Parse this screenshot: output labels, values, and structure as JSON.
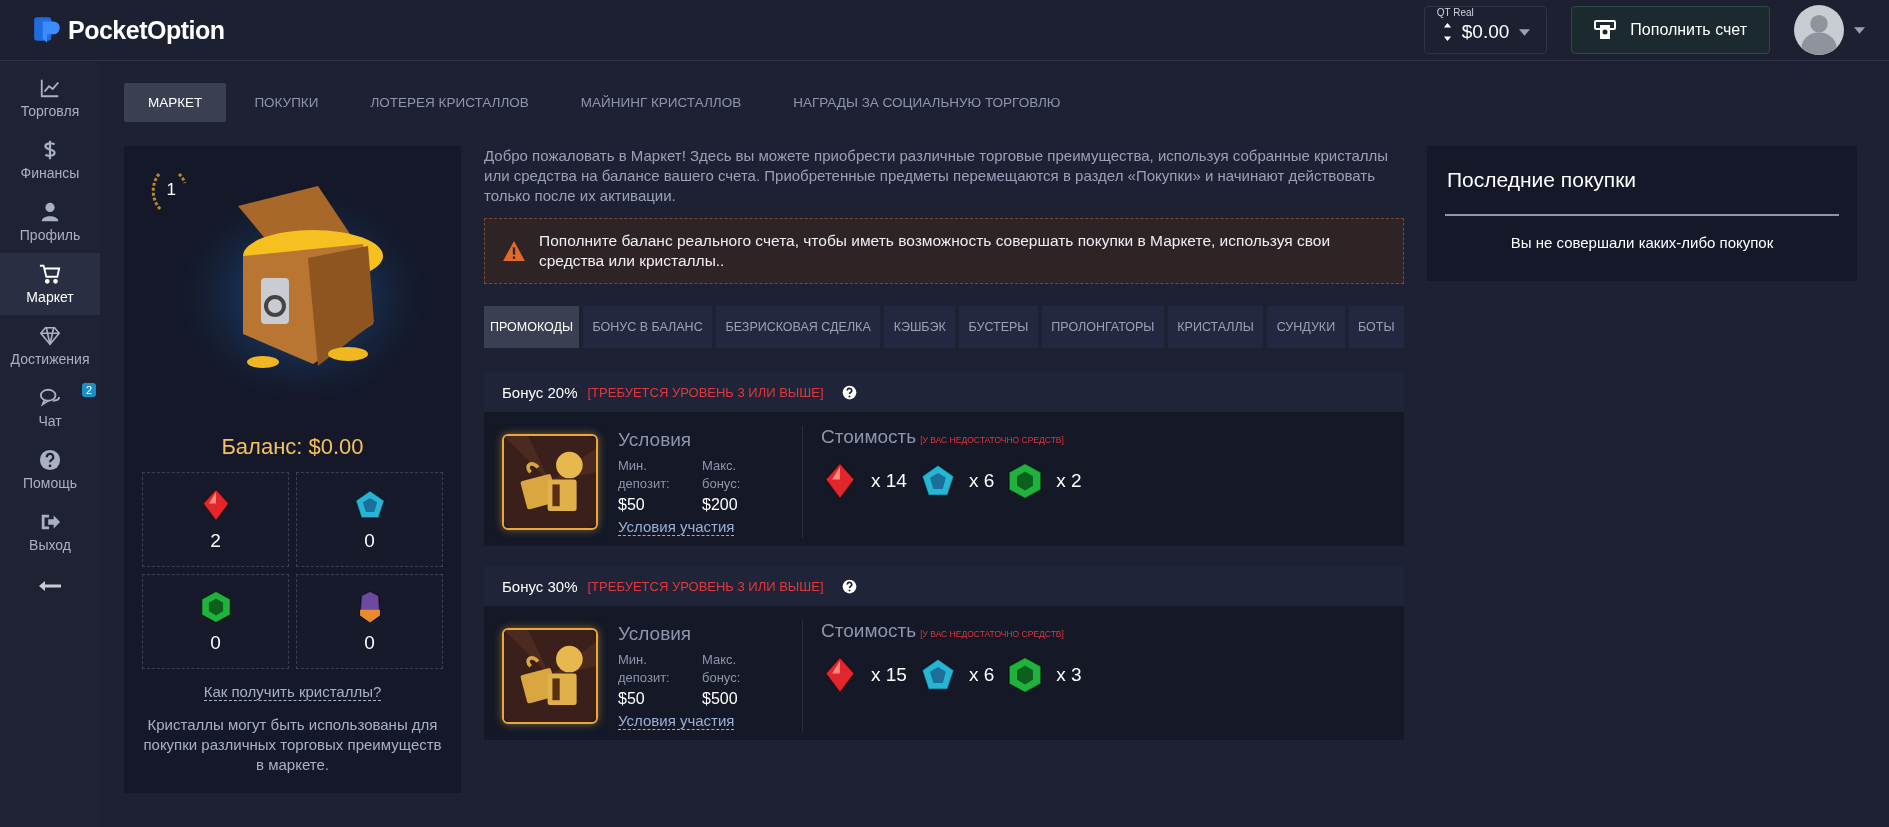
{
  "header": {
    "logo": "PocketOption",
    "account": {
      "label": "QT Real",
      "balance": "$0.00"
    },
    "deposit_button": "Пополнить счет"
  },
  "sidebar": {
    "items": [
      {
        "kind": "chart",
        "label": "Торговля",
        "selected": false
      },
      {
        "kind": "dollar",
        "label": "Финансы",
        "selected": false
      },
      {
        "kind": "user",
        "label": "Профиль",
        "selected": false
      },
      {
        "kind": "cart",
        "label": "Маркет",
        "selected": true
      },
      {
        "kind": "diamond",
        "label": "Достижения",
        "selected": false
      },
      {
        "kind": "chat",
        "label": "Чат",
        "selected": false,
        "badge": "2"
      },
      {
        "kind": "help",
        "label": "Помощь",
        "selected": false
      },
      {
        "kind": "exit",
        "label": "Выход",
        "selected": false
      }
    ]
  },
  "tabs": [
    {
      "label": "МАРКЕТ",
      "selected": true
    },
    {
      "label": "ПОКУПКИ",
      "selected": false
    },
    {
      "label": "ЛОТЕРЕЯ КРИСТАЛЛОВ",
      "selected": false
    },
    {
      "label": "МАЙНИНГ КРИСТАЛЛОВ",
      "selected": false
    },
    {
      "label": "НАГРАДЫ ЗА СОЦИАЛЬНУЮ ТОРГОВЛЮ",
      "selected": false
    }
  ],
  "wallet": {
    "level_badge": "1",
    "balance": "Баланс: $0.00",
    "crystals": [
      {
        "kind": "ruby",
        "count": "2"
      },
      {
        "kind": "sapphire",
        "count": "0"
      },
      {
        "kind": "emerald",
        "count": "0"
      },
      {
        "kind": "amethyst",
        "count": "0"
      }
    ],
    "help_link": "Как получить кристаллы?",
    "description": "Кристаллы могут быть использованы для покупки различных торговых преимуществ в маркете."
  },
  "intro": "Добро пожаловать в Маркет! Здесь вы можете приобрести различные торговые преимущества, используя собранные кристаллы или средства на балансе вашего счета. Приобретенные предметы перемещаются в раздел «Покупки» и начинают действовать только после их активации.",
  "alert": "Пополните баланс реального счета, чтобы иметь возможность совершать покупки в Маркете, используя свои средства или кристаллы..",
  "categories": [
    {
      "label": "ПРОМОКОДЫ",
      "selected": true
    },
    {
      "label": "БОНУС В БАЛАНС",
      "selected": false
    },
    {
      "label": "БЕЗРИСКОВАЯ СДЕЛКА",
      "selected": false
    },
    {
      "label": "КЭШБЭК",
      "selected": false
    },
    {
      "label": "БУСТЕРЫ",
      "selected": false
    },
    {
      "label": "ПРОЛОНГАТОРЫ",
      "selected": false
    },
    {
      "label": "КРИСТАЛЛЫ",
      "selected": false
    },
    {
      "label": "СУНДУКИ",
      "selected": false
    },
    {
      "label": "БОТЫ",
      "selected": false
    }
  ],
  "products": [
    {
      "title": "Бонус 20%",
      "requirement": "[ТРЕБУЕТСЯ УРОВЕНЬ 3 ИЛИ ВЫШЕ]",
      "conditions_title": "Условия",
      "min_label": "Мин. депозит:",
      "min_value": "$50",
      "max_label": "Макс. бонус:",
      "max_value": "$200",
      "terms_link": "Условия участия",
      "cost_title": "Стоимость",
      "cost_note": "[У ВАС НЕДОСТАТОЧНО СРЕДСТВ]",
      "cost": [
        {
          "kind": "ruby",
          "amount": "x 14"
        },
        {
          "kind": "sapphire",
          "amount": "x 6"
        },
        {
          "kind": "emerald",
          "amount": "x 2"
        }
      ]
    },
    {
      "title": "Бонус 30%",
      "requirement": "[ТРЕБУЕТСЯ УРОВЕНЬ 3 ИЛИ ВЫШЕ]",
      "conditions_title": "Условия",
      "min_label": "Мин. депозит:",
      "min_value": "$50",
      "max_label": "Макс. бонус:",
      "max_value": "$500",
      "terms_link": "Условия участия",
      "cost_title": "Стоимость",
      "cost_note": "[У ВАС НЕДОСТАТОЧНО СРЕДСТВ]",
      "cost": [
        {
          "kind": "ruby",
          "amount": "x 15"
        },
        {
          "kind": "sapphire",
          "amount": "x 6"
        },
        {
          "kind": "emerald",
          "amount": "x 3"
        }
      ]
    }
  ],
  "recent": {
    "title": "Последние покупки",
    "empty": "Вы не совершали каких-либо покупок"
  }
}
